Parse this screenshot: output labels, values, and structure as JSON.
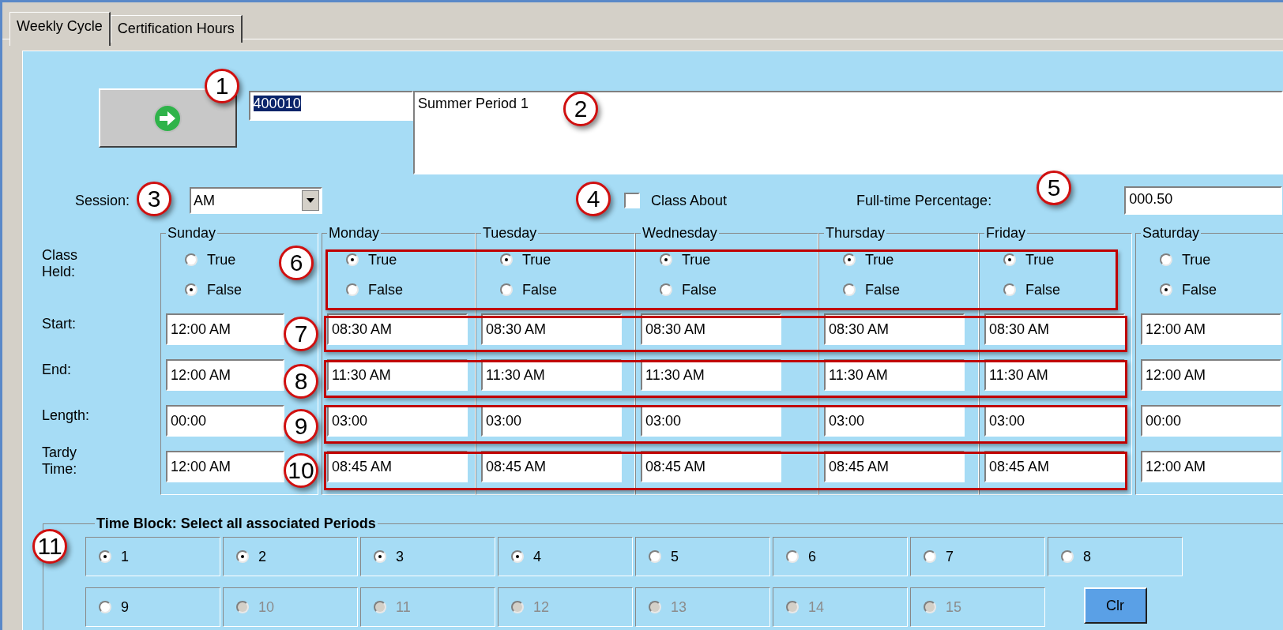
{
  "tabs": [
    {
      "label": "Weekly Cycle",
      "selected": true
    },
    {
      "label": "Certification Hours",
      "selected": false
    }
  ],
  "id_field": {
    "value": "400010",
    "text_selected": true
  },
  "description": {
    "value": "Summer Period 1"
  },
  "session": {
    "label": "Session:",
    "value": "AM"
  },
  "class_about": {
    "label": "Class About",
    "checked": false
  },
  "full_time_percentage": {
    "label": "Full-time Percentage:",
    "value": "000.50"
  },
  "row_labels": [
    "Class Held:",
    "Start:",
    "End:",
    "Length:",
    "Tardy Time:"
  ],
  "days": [
    {
      "name": "Sunday",
      "options": [
        {
          "label": "True",
          "selected": false
        },
        {
          "label": "False",
          "selected": true
        }
      ],
      "start": "12:00 AM",
      "end": "12:00 AM",
      "length": "00:00",
      "tardy": "12:00 AM"
    },
    {
      "name": "Monday",
      "options": [
        {
          "label": "True",
          "selected": true
        },
        {
          "label": "False",
          "selected": false
        }
      ],
      "start": "08:30 AM",
      "end": "11:30 AM",
      "length": "03:00",
      "tardy": "08:45 AM"
    },
    {
      "name": "Tuesday",
      "options": [
        {
          "label": "True",
          "selected": true
        },
        {
          "label": "False",
          "selected": false
        }
      ],
      "start": "08:30 AM",
      "end": "11:30 AM",
      "length": "03:00",
      "tardy": "08:45 AM"
    },
    {
      "name": "Wednesday",
      "options": [
        {
          "label": "True",
          "selected": true
        },
        {
          "label": "False",
          "selected": false
        }
      ],
      "start": "08:30 AM",
      "end": "11:30 AM",
      "length": "03:00",
      "tardy": "08:45 AM"
    },
    {
      "name": "Thursday",
      "options": [
        {
          "label": "True",
          "selected": true
        },
        {
          "label": "False",
          "selected": false
        }
      ],
      "start": "08:30 AM",
      "end": "11:30 AM",
      "length": "03:00",
      "tardy": "08:45 AM"
    },
    {
      "name": "Friday",
      "options": [
        {
          "label": "True",
          "selected": true
        },
        {
          "label": "False",
          "selected": false
        }
      ],
      "start": "08:30 AM",
      "end": "11:30 AM",
      "length": "03:00",
      "tardy": "08:45 AM"
    },
    {
      "name": "Saturday",
      "options": [
        {
          "label": "True",
          "selected": false
        },
        {
          "label": "False",
          "selected": true
        }
      ],
      "start": "12:00 AM",
      "end": "12:00 AM",
      "length": "00:00",
      "tardy": "12:00 AM"
    }
  ],
  "time_block": {
    "title": "Time Block: Select all associated Periods",
    "periods": [
      {
        "label": "1",
        "selected": true,
        "disabled": false
      },
      {
        "label": "2",
        "selected": true,
        "disabled": false
      },
      {
        "label": "3",
        "selected": true,
        "disabled": false
      },
      {
        "label": "4",
        "selected": true,
        "disabled": false
      },
      {
        "label": "5",
        "selected": false,
        "disabled": false
      },
      {
        "label": "6",
        "selected": false,
        "disabled": false
      },
      {
        "label": "7",
        "selected": false,
        "disabled": false
      },
      {
        "label": "8",
        "selected": false,
        "disabled": false
      },
      {
        "label": "9",
        "selected": false,
        "disabled": false
      },
      {
        "label": "10",
        "selected": false,
        "disabled": true
      },
      {
        "label": "11",
        "selected": false,
        "disabled": true
      },
      {
        "label": "12",
        "selected": false,
        "disabled": true
      },
      {
        "label": "13",
        "selected": false,
        "disabled": true
      },
      {
        "label": "14",
        "selected": false,
        "disabled": true
      },
      {
        "label": "15",
        "selected": false,
        "disabled": true
      }
    ],
    "clear_button": "Clr"
  },
  "callouts": [
    "1",
    "2",
    "3",
    "4",
    "5",
    "6",
    "7",
    "8",
    "9",
    "10",
    "11"
  ]
}
